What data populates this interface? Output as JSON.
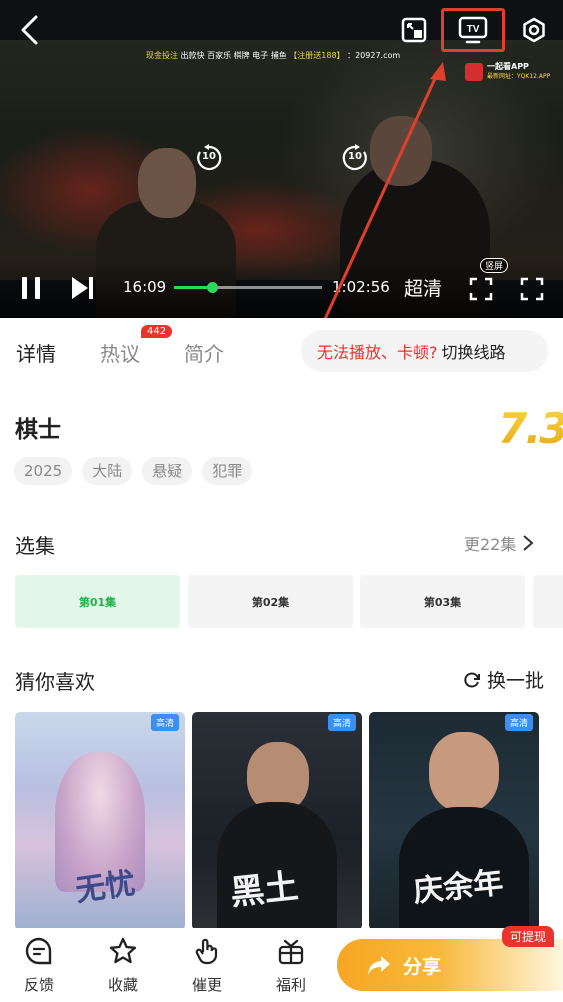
{
  "player": {
    "ad_prefix": "现金投注",
    "ad_text": "出款快 百家乐 棋牌 电子 捕鱼",
    "ad_code": "【注册送188】",
    "ad_site": "：20927.com",
    "app_name": "一起看APP",
    "app_url": "最新网址：YQK12.APP",
    "rewind_seconds": "10",
    "forward_seconds": "10",
    "current_time": "16:09",
    "total_time": "1:02:56",
    "progress": 0.26,
    "quality": "超清",
    "portrait_label": "竖屏"
  },
  "tabs": [
    {
      "label": "详情"
    },
    {
      "label": "热议",
      "badge": "442"
    },
    {
      "label": "简介"
    }
  ],
  "switch_line": {
    "warning": "无法播放、卡顿?",
    "action": "切换线路"
  },
  "show": {
    "title": "棋士",
    "rating": "7.3",
    "tags": [
      "2025",
      "大陆",
      "悬疑",
      "犯罪"
    ]
  },
  "episodes": {
    "title": "选集",
    "more": "更22集",
    "items": [
      "第01集",
      "第02集",
      "第03集"
    ]
  },
  "recommend": {
    "title": "猜你喜欢",
    "refresh": "换一批",
    "items": [
      {
        "badge": "高清",
        "art_text": "无忧"
      },
      {
        "badge": "高清",
        "art_text": "黑土"
      },
      {
        "badge": "高清",
        "art_text": "庆余年"
      }
    ]
  },
  "bottom_bar": {
    "feedback": "反馈",
    "favorite": "收藏",
    "urge": "催更",
    "welfare": "福利",
    "share": "分享",
    "withdraw": "可提现"
  },
  "colors": {
    "accent_green": "#2fd65f",
    "highlight_red": "#e0402b",
    "rating_gold": "#f2c21a",
    "share_orange": "#f6a623"
  }
}
